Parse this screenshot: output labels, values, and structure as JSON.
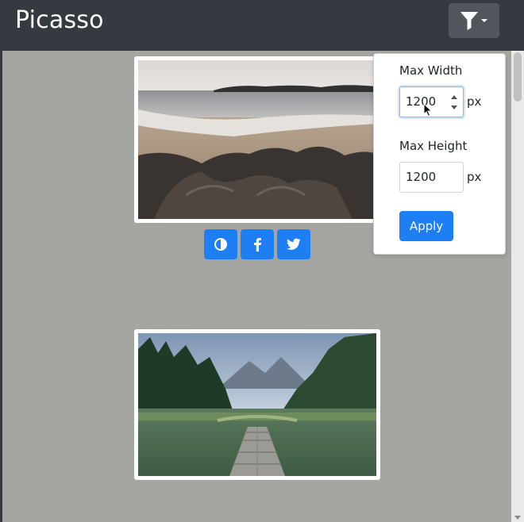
{
  "app": {
    "title": "Picasso"
  },
  "navbar": {
    "filter_icon": "filter-icon",
    "caret_icon": "caret-down-icon"
  },
  "photos": [
    {
      "subject": "beach-with-rocks"
    },
    {
      "subject": "lake-with-pier"
    }
  ],
  "actions": [
    {
      "icon": "contrast-icon"
    },
    {
      "icon": "facebook-icon"
    },
    {
      "icon": "twitter-icon"
    }
  ],
  "filter_panel": {
    "max_width_label": "Max Width",
    "max_width_value": "1200",
    "max_height_label": "Max Height",
    "max_height_value": "1200",
    "unit_label": "px",
    "apply_label": "Apply"
  },
  "colors": {
    "navbar": "#343a40",
    "page_bg": "#a5a5a2",
    "accent": "#1e7ef4"
  }
}
